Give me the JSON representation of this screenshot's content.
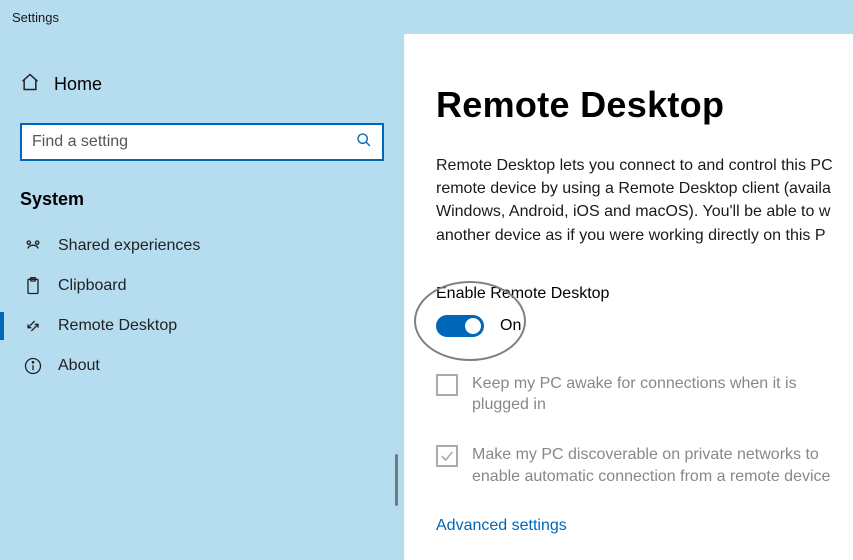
{
  "titlebar": {
    "title": "Settings"
  },
  "sidebar": {
    "home": "Home",
    "search_placeholder": "Find a setting",
    "group_heading": "System",
    "items": [
      {
        "label": "Shared experiences"
      },
      {
        "label": "Clipboard"
      },
      {
        "label": "Remote Desktop"
      },
      {
        "label": "About"
      }
    ]
  },
  "main": {
    "title": "Remote Desktop",
    "description": "Remote Desktop lets you connect to and control this PC remote device by using a Remote Desktop client (availa Windows, Android, iOS and macOS). You'll be able to w another device as if you were working directly on this P",
    "toggle_label": "Enable Remote Desktop",
    "toggle_state": "On",
    "option_keep_awake": "Keep my PC awake for connections when it is plugged in",
    "option_discoverable": "Make my PC discoverable on private networks to enable automatic connection from a remote device",
    "advanced_link": "Advanced settings"
  }
}
